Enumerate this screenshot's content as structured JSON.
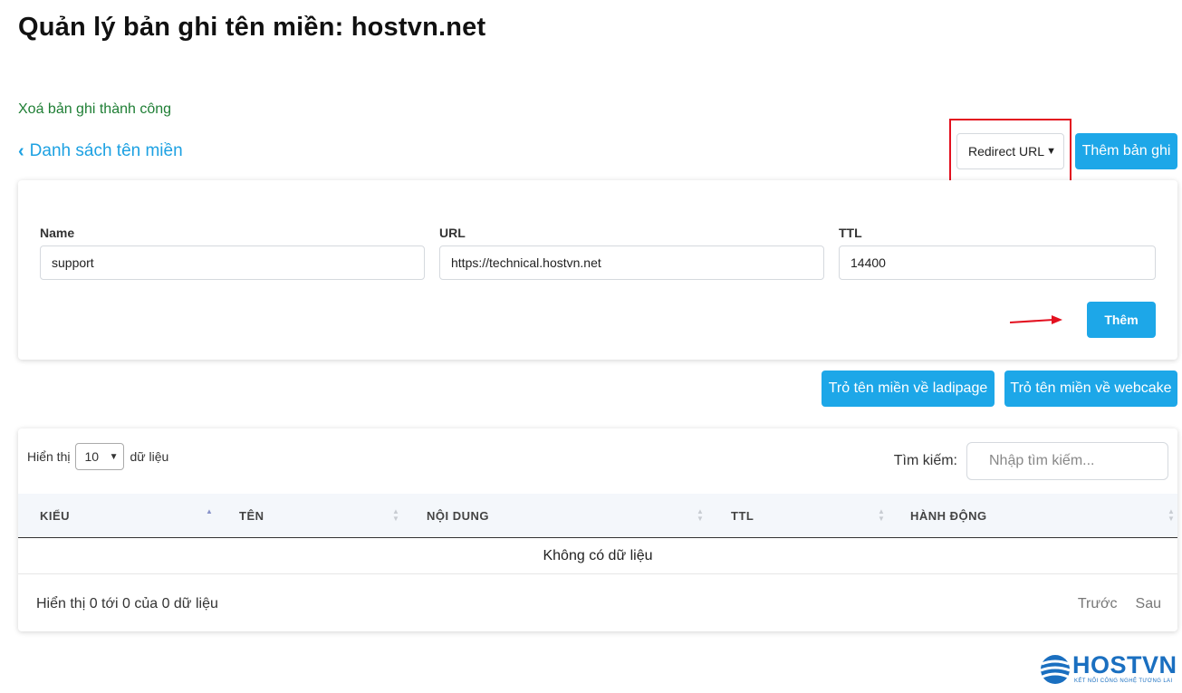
{
  "page": {
    "title": "Quản lý bản ghi tên miền: hostvn.net",
    "alert_success": "Xoá bản ghi thành công",
    "back_link": "Danh sách tên miền"
  },
  "toolbar": {
    "record_type_selected": "Redirect URL",
    "add_record_label": "Thêm bản ghi"
  },
  "form": {
    "name_label": "Name",
    "name_value": "support",
    "url_label": "URL",
    "url_value": "https://technical.hostvn.net",
    "ttl_label": "TTL",
    "ttl_value": "14400",
    "submit_label": "Thêm"
  },
  "quick_actions": {
    "ladipage_label": "Trỏ tên miền về ladipage",
    "webcake_label": "Trỏ tên miền về webcake"
  },
  "table": {
    "length_prefix": "Hiển thị",
    "length_value": "10",
    "length_suffix": "dữ liệu",
    "search_label": "Tìm kiếm:",
    "search_placeholder": "Nhập tìm kiếm...",
    "columns": [
      "KIỂU",
      "TÊN",
      "NỘI DUNG",
      "TTL",
      "HÀNH ĐỘNG"
    ],
    "sorted_column": "KIỂU",
    "empty_text": "Không có dữ liệu",
    "info_text": "Hiển thị 0 tới 0 của 0 dữ liệu",
    "prev_label": "Trước",
    "next_label": "Sau"
  },
  "brand": {
    "logo_text": "HOSTVN",
    "tagline": "KẾT NỐI CÔNG NGHỆ TƯƠNG LAI"
  },
  "colors": {
    "primary_button": "#1da7e8",
    "link": "#1da1e2",
    "success_text": "#1e7e34",
    "highlight_box": "#e3101f",
    "annotation_arrow": "#e3101f"
  },
  "icons": {
    "back": "chevron-left-icon",
    "select": "chevron-down-icon",
    "sort": "sort-icon",
    "annotation": "red-arrow-icon"
  }
}
